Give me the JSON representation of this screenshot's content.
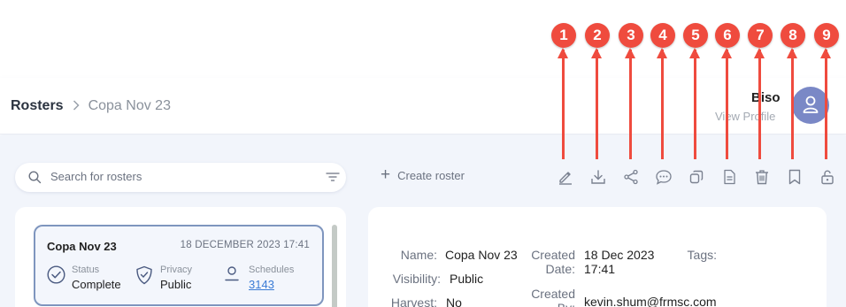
{
  "callouts": [
    "1",
    "2",
    "3",
    "4",
    "5",
    "6",
    "7",
    "8",
    "9"
  ],
  "breadcrumb": {
    "root": "Rosters",
    "separator": ">",
    "current": "Copa Nov 23"
  },
  "user": {
    "name": "Biso",
    "link": "View Profile"
  },
  "search": {
    "placeholder": "Search for rosters"
  },
  "create_label": "Create roster",
  "toolbar_icons": [
    "edit-icon",
    "download-icon",
    "share-icon",
    "comment-icon",
    "duplicate-icon",
    "document-icon",
    "trash-icon",
    "bookmark-icon",
    "unlock-icon"
  ],
  "roster_card": {
    "title": "Copa Nov 23",
    "date": "18 DECEMBER 2023 17:41",
    "status_label": "Status",
    "status_value": "Complete",
    "privacy_label": "Privacy",
    "privacy_value": "Public",
    "schedules_label": "Schedules",
    "schedules_value": "3143"
  },
  "detail": {
    "name_label": "Name:",
    "name_value": "Copa Nov 23",
    "created_date_label": "Created Date:",
    "created_date_value": "18 Dec 2023 17:41",
    "tags_label": "Tags:",
    "visibility_label": "Visibility:",
    "visibility_value": "Public",
    "created_by_label": "Created By:",
    "created_by_value": "kevin.shum@frmsc.com",
    "harvest_label": "Harvest:",
    "harvest_value": "No"
  },
  "colors": {
    "callout": "#ef4b3e",
    "accent": "#7e95be",
    "link": "#3a7bd5",
    "avatar": "#7a88c6"
  }
}
